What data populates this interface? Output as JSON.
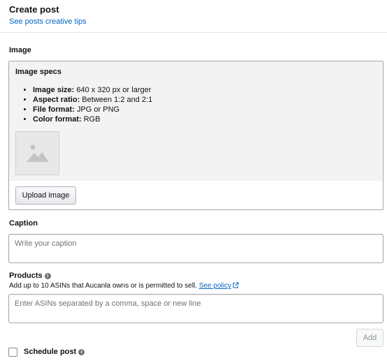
{
  "header": {
    "title": "Create post",
    "tips_link": "See posts creative tips"
  },
  "image_section": {
    "label": "Image",
    "specs_title": "Image specs",
    "specs": [
      {
        "name": "Image size:",
        "value": " 640 x 320 px or larger"
      },
      {
        "name": "Aspect ratio:",
        "value": " Between 1:2 and 2:1"
      },
      {
        "name": "File format:",
        "value": " JPG or PNG"
      },
      {
        "name": "Color format:",
        "value": " RGB"
      }
    ],
    "placeholder_icon": "image-placeholder-icon",
    "upload_button": "Upload image"
  },
  "caption": {
    "label": "Caption",
    "placeholder": "Write your caption",
    "value": ""
  },
  "products": {
    "label": "Products",
    "info_icon": "info-icon",
    "help_text": "Add up to 10 ASINs that Aucanla owns or is permitted to sell. ",
    "policy_link": "See policy",
    "policy_icon": "external-link-icon",
    "placeholder": "Enter ASINs separated by a comma, space or new line",
    "value": "",
    "add_button": "Add"
  },
  "schedule": {
    "label": "Schedule post",
    "checked": false,
    "info_icon": "info-icon"
  },
  "colors": {
    "link": "#0066c0",
    "specs_background": "#f3f3f3",
    "border": "#a6a6a6",
    "disabled_text": "#8d9096"
  }
}
